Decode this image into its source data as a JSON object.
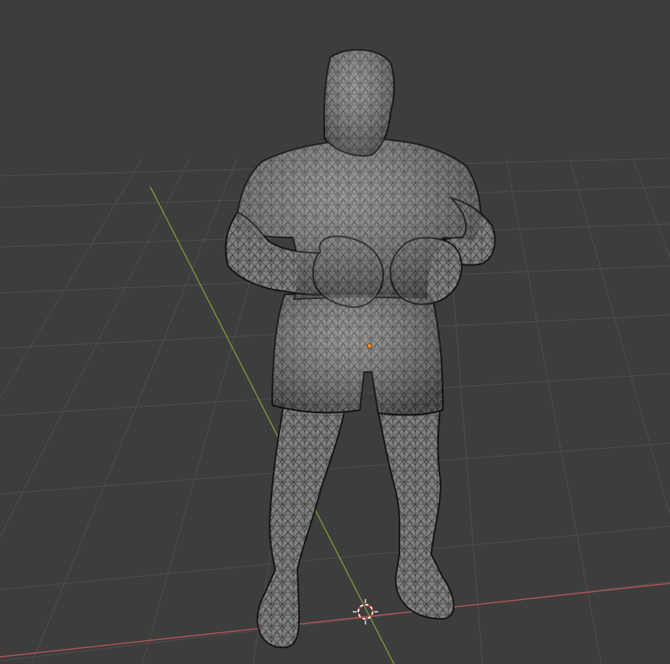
{
  "viewport": {
    "background_color": "#3d3d3d",
    "grid_color": "#4f4f4f",
    "x_axis_color": "#b4535b",
    "y_axis_color": "#7a9a3a",
    "mesh_fill_color": "#7b7b7b",
    "wire_color": "#1e1e1e",
    "origin_color": "#f08a1c",
    "cursor_colors": [
      "#e0403a",
      "#ffffff"
    ]
  },
  "scene": {
    "object": "boxer-figure-mesh",
    "shading": "wireframe-overlay",
    "selected": false
  },
  "icons": [
    "3d-cursor-icon",
    "object-origin-icon"
  ]
}
